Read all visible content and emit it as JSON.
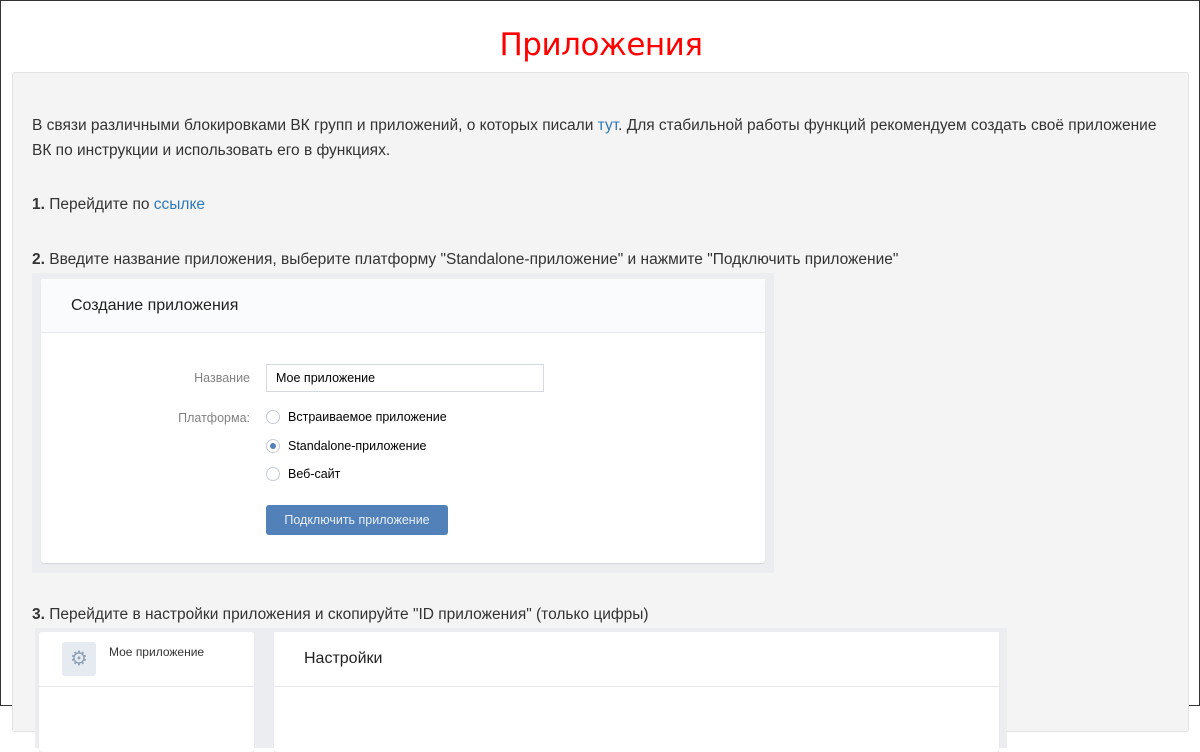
{
  "page_title": "Приложения",
  "intro": {
    "before": "В связи различными блокировками ВК групп и приложений, о которых писали ",
    "link": "тут",
    "after": ". Для стабильной работы функций рекомендуем создать своё приложение ВК по инструкции и использовать его в функциях."
  },
  "step1": {
    "num": "1.",
    "text": " Перейдите по ",
    "link": "ссылке"
  },
  "step2": {
    "num": "2.",
    "text": " Введите название приложения, выберите платформу \"Standalone-приложение\" и нажмите \"Подключить приложение\""
  },
  "step3": {
    "num": "3.",
    "text": " Перейдите в настройки приложения и скопируйте \"ID приложения\" (только цифры)"
  },
  "create_form": {
    "title": "Создание приложения",
    "name_label": "Название",
    "name_value": "Мое приложение",
    "platform_label": "Платформа:",
    "options": [
      "Встраиваемое приложение",
      "Standalone-приложение",
      "Веб-сайт"
    ],
    "selected": 1,
    "submit": "Подключить приложение"
  },
  "settings": {
    "app_name": "Мое приложение",
    "title": "Настройки"
  }
}
